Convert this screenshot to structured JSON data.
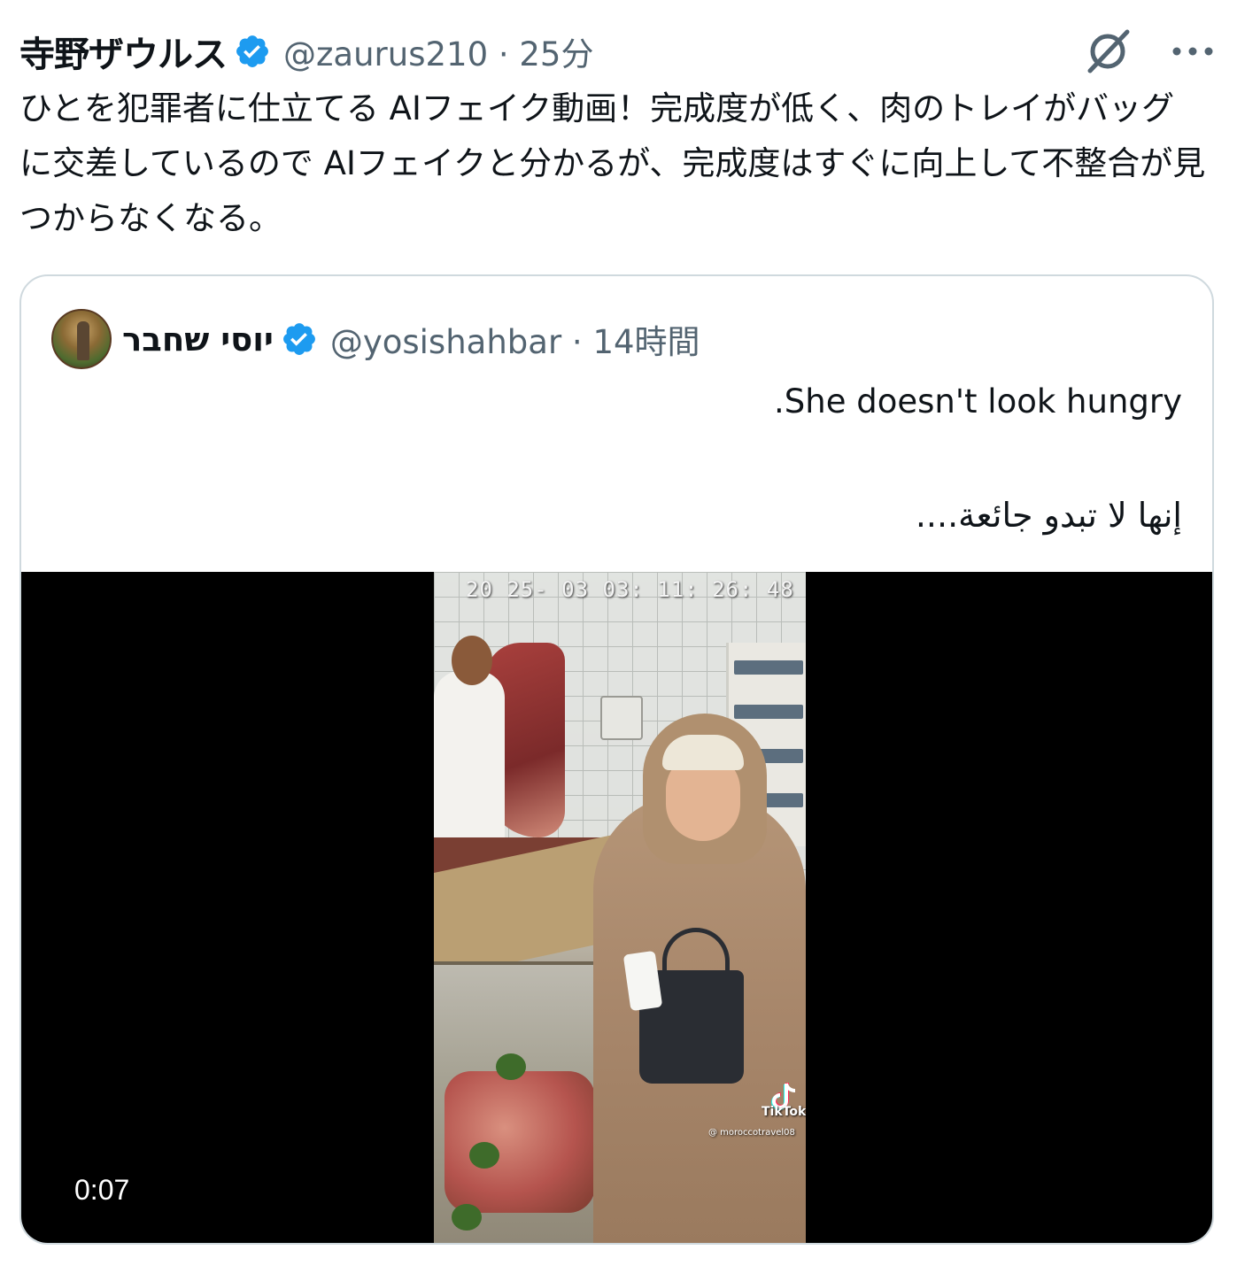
{
  "tweet": {
    "author_name": "寺野ザウルス",
    "handle_time": "@zaurus210 · 25分",
    "text": "ひとを犯罪者に仕立てる AIフェイク動画！完成度が低く、肉のトレイがバッグに交差しているので AIフェイクと分かるが、完成度はすぐに向上して不整合が見つからなくなる。"
  },
  "quoted": {
    "author_name": "יוסי שחבר",
    "handle_time": "@yosishahbar · 14時間",
    "line_en": ".She doesn't look hungry",
    "line_ar": "إنها لا تبدو جائعة....",
    "video": {
      "overlay_timestamp": "20 25- 03 03: 11: 26: 48",
      "watermark_brand": "TikTok",
      "watermark_user": "@ moroccotravel08",
      "duration": "0:07"
    }
  },
  "colors": {
    "verified": "#1d9bf0",
    "secondary_text": "#536471",
    "border": "#cfd9de"
  },
  "icons": {
    "verified": "verified-badge-icon",
    "grok": "grok-icon",
    "more": "more-icon"
  }
}
